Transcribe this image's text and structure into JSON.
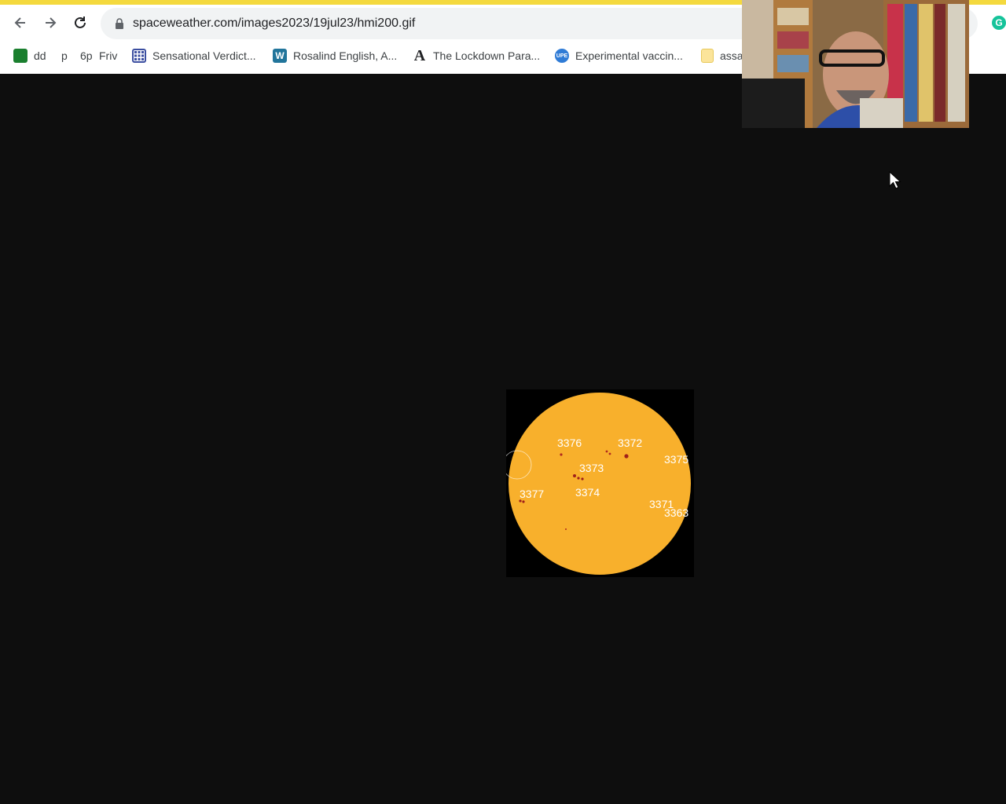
{
  "browser": {
    "url": "spaceweather.com/images2023/19jul23/hmi200.gif",
    "accent_color": "#f4d93e",
    "back_icon": "arrow-left-icon",
    "forward_icon": "arrow-right-icon",
    "reload_icon": "reload-icon",
    "lock_icon": "lock-icon",
    "extension_icon": "grammarly-icon",
    "extension_letter": "G"
  },
  "bookmarks": [
    {
      "label": "dd",
      "icon": "green-app-icon"
    },
    {
      "label": "p",
      "icon": ""
    },
    {
      "label": "6p",
      "icon": ""
    },
    {
      "label": "Friv",
      "icon": ""
    },
    {
      "label": "Sensational Verdict...",
      "icon": "grid-icon"
    },
    {
      "label": "Rosalind English, A...",
      "icon": "wordpress-icon",
      "icon_letter": "W"
    },
    {
      "label": "The Lockdown Para...",
      "icon": "letter-a-icon",
      "icon_letter": "A"
    },
    {
      "label": "Experimental vaccin...",
      "icon": "globe-blue-icon",
      "icon_letter": "UPE"
    },
    {
      "label": "assa",
      "icon": "folder-icon"
    }
  ],
  "sun_image": {
    "background": "#000000",
    "disk_color": "#f8b02c",
    "regions": [
      "3376",
      "3372",
      "3375",
      "3373",
      "3377",
      "3374",
      "3371",
      "3363"
    ]
  },
  "webcam": {
    "description_icon": "webcam-overlay"
  }
}
